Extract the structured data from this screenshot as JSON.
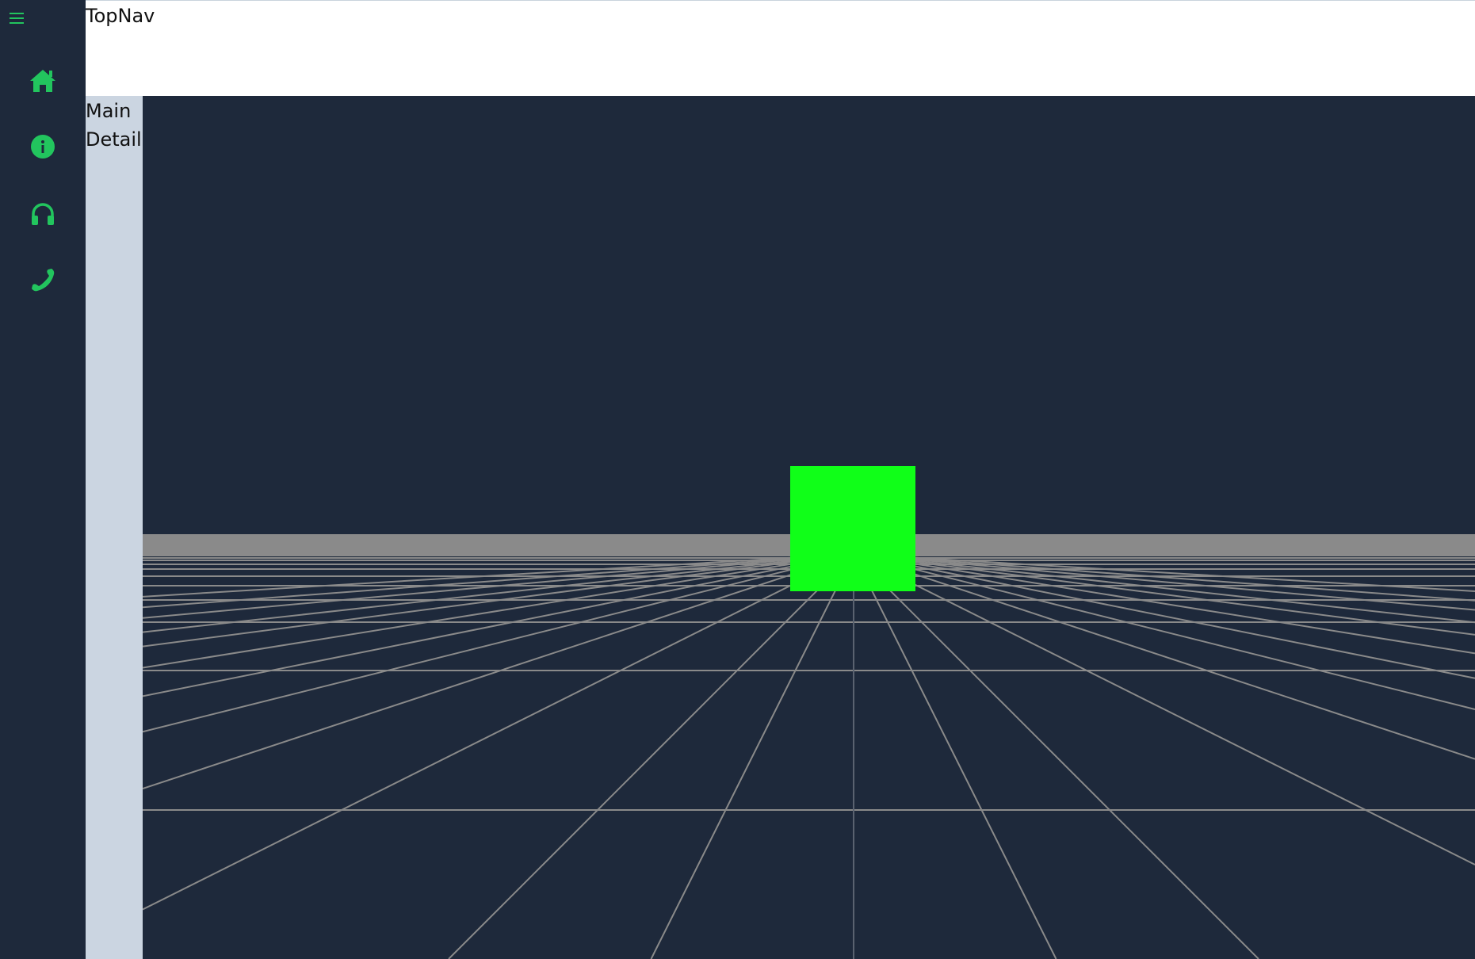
{
  "topnav": {
    "label": "TopNav"
  },
  "sidebar": {
    "menu_icon": "hamburger-menu-icon",
    "items": [
      {
        "icon": "home-icon"
      },
      {
        "icon": "info-icon"
      },
      {
        "icon": "headphones-icon"
      },
      {
        "icon": "phone-icon"
      }
    ]
  },
  "subnav": {
    "links": [
      {
        "label": "Main"
      },
      {
        "label": "Details"
      }
    ]
  },
  "scene": {
    "background": "#1e293b",
    "floor_grid_color": "#8a8a8a",
    "cube_color": "#10ff18"
  },
  "colors": {
    "accent": "#22c55e",
    "sidebar_bg": "#1e293b",
    "subnav_bg": "#cbd5e1"
  }
}
